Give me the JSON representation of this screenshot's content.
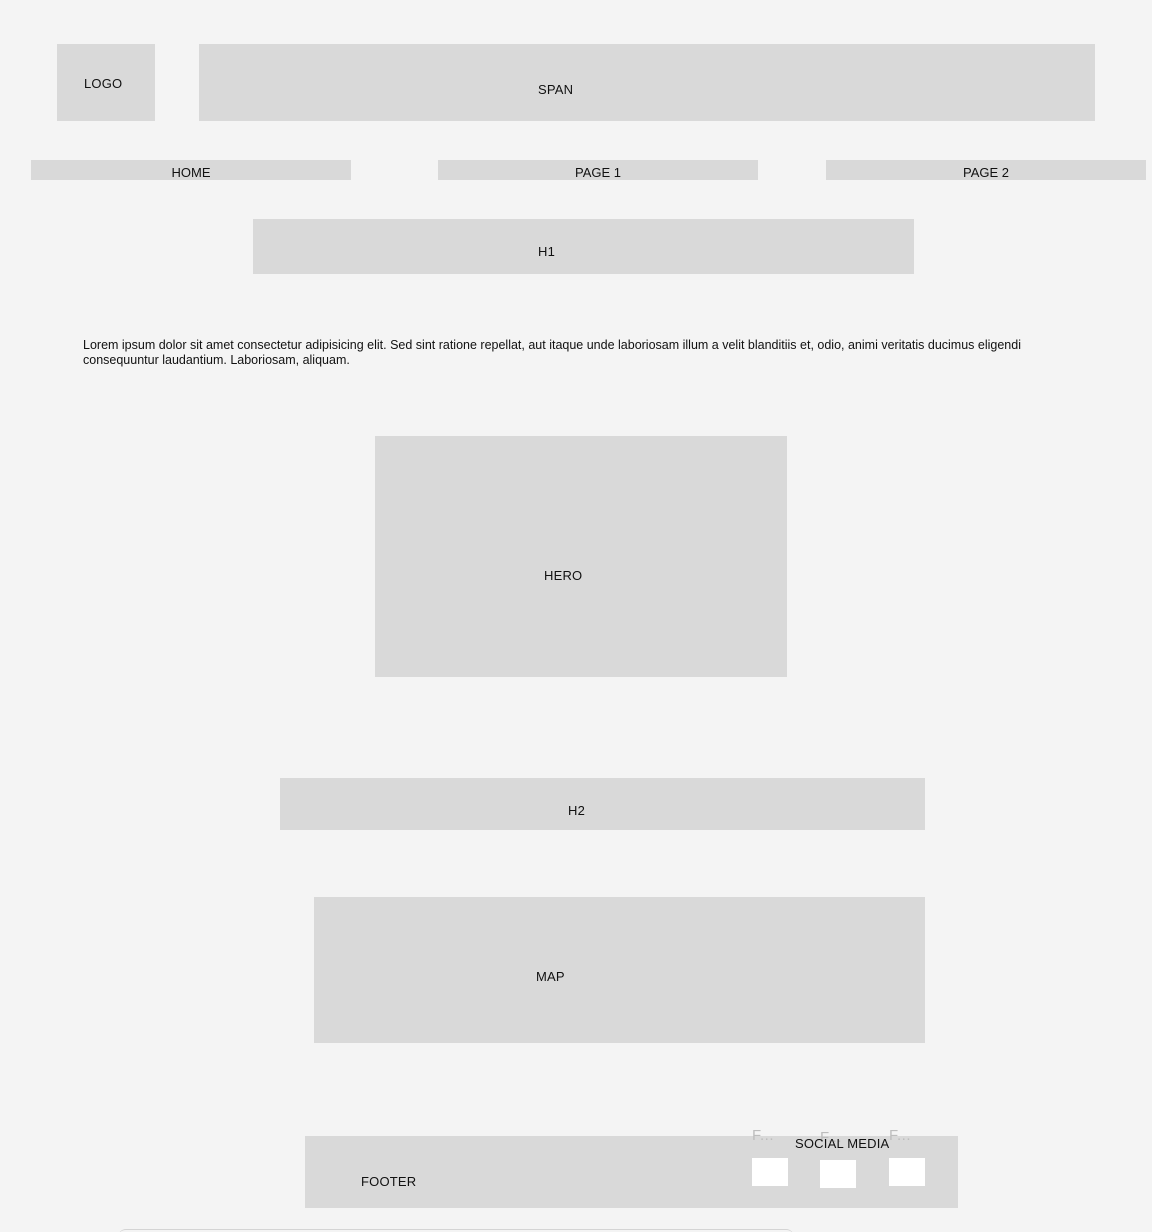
{
  "header": {
    "logo_label": "LOGO",
    "span_label": "SPAN"
  },
  "nav": {
    "items": [
      {
        "label": "HOME"
      },
      {
        "label": "PAGE 1"
      },
      {
        "label": "PAGE 2"
      }
    ]
  },
  "main": {
    "h1_label": "H1",
    "paragraph": "Lorem ipsum dolor sit amet consectetur adipisicing elit. Sed sint ratione repellat, aut itaque unde laboriosam illum a velit blanditiis et, odio, animi veritatis ducimus eligendi consequuntur laudantium. Laboriosam, aliquam.",
    "hero_label": "HERO",
    "h2_label": "H2",
    "map_label": "MAP"
  },
  "footer": {
    "label": "FOOTER",
    "social_title": "SOCIAL MEDIA",
    "social_items": [
      {
        "label": "F..."
      },
      {
        "label": "F..."
      },
      {
        "label": "F..."
      }
    ]
  },
  "colors": {
    "background": "#f4f4f4",
    "placeholder": "#d9d9d9",
    "social_box": "#ffffff"
  }
}
